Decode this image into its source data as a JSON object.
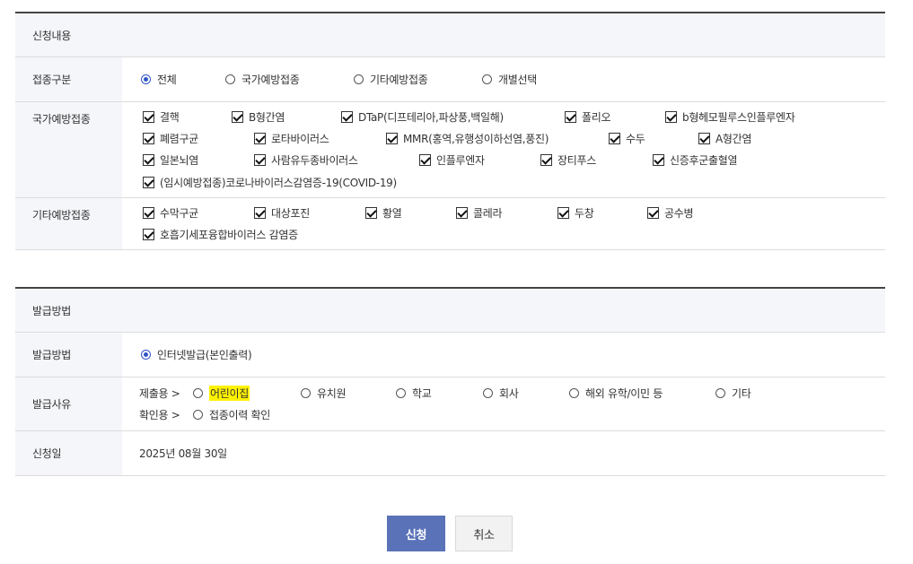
{
  "section1": {
    "title": "신청내용",
    "rows": {
      "type": {
        "label": "접종구분",
        "options": [
          "전체",
          "국가예방접종",
          "기타예방접종",
          "개별선택"
        ],
        "selected": "전체"
      },
      "national": {
        "label": "국가예방접종",
        "items": [
          "결핵",
          "B형간염",
          "DTaP(디프테리아,파상풍,백일해)",
          "폴리오",
          "b형헤모필루스인플루엔자",
          "폐렴구균",
          "로타바이러스",
          "MMR(홍역,유행성이하선염,풍진)",
          "수두",
          "A형간염",
          "일본뇌염",
          "사람유두종바이러스",
          "인플루엔자",
          "장티푸스",
          "신증후군출혈열",
          "(임시예방접종)코로나바이러스감염증-19(COVID-19)"
        ]
      },
      "other": {
        "label": "기타예방접종",
        "items": [
          "수막구균",
          "대상포진",
          "황열",
          "콜레라",
          "두창",
          "공수병",
          "호흡기세포융합바이러스 감염증"
        ]
      }
    }
  },
  "section2": {
    "title": "발급방법",
    "rows": {
      "method": {
        "label": "발급방법",
        "option": "인터넷발급(본인출력)"
      },
      "reason": {
        "label": "발급사유",
        "submit_prefix": "제출용 >",
        "submit_options": [
          "어린이집",
          "유치원",
          "학교",
          "회사",
          "해외 유학/이민 등",
          "기타"
        ],
        "confirm_prefix": "확인용 >",
        "confirm_option": "접종이력 확인"
      },
      "date": {
        "label": "신청일",
        "value": "2025년 08월 30일"
      }
    }
  },
  "buttons": {
    "submit": "신청",
    "cancel": "취소"
  },
  "colors": {
    "accent": "#5a73b8",
    "radio_selected": "#2f54c7",
    "highlight": "#fff200",
    "header_bg": "#f4f6f9"
  }
}
